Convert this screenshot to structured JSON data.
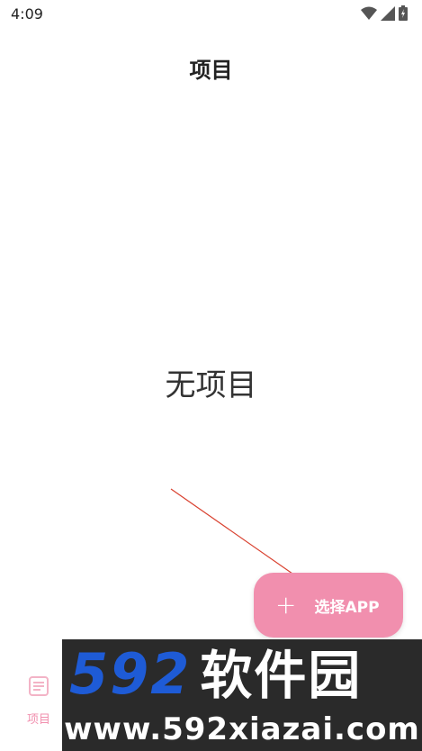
{
  "status_bar": {
    "time": "4:09",
    "icons": [
      "wifi-icon",
      "signal-icon",
      "battery-icon"
    ]
  },
  "page": {
    "title": "项目",
    "empty_message": "无项目"
  },
  "fab": {
    "icon": "plus-icon",
    "label": "选择APP",
    "color": "#f18fae"
  },
  "bottom_nav": {
    "items": [
      {
        "label": "项目",
        "icon": "list-icon",
        "active": true
      }
    ]
  },
  "annotation": {
    "arrow_color": "#d9412f"
  },
  "watermark": {
    "brand_number": "592",
    "brand_name": "软件园",
    "url": "www.592xiazai.com"
  },
  "colors": {
    "accent": "#f18fae",
    "watermark_blue": "#1e5bd6"
  }
}
